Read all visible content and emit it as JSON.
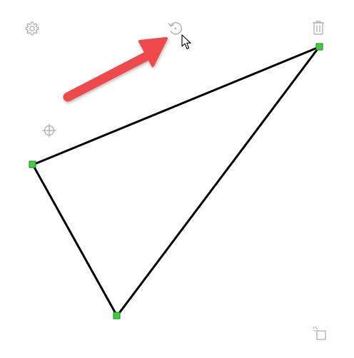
{
  "toolbar": {
    "settings_icon": "gear-icon",
    "rotate_icon": "rotate-icon",
    "delete_icon": "trash-icon",
    "center_icon": "crosshair-icon",
    "resize_icon": "resize-corner-icon"
  },
  "shape": {
    "type": "triangle",
    "stroke_color": "#000000",
    "handle_color": "#3ecf3e"
  },
  "annotation": {
    "arrow_color": "#f0484b",
    "pointer": "mouse-cursor-icon"
  },
  "colors": {
    "icon_gray": "#b5b5b5",
    "background": "#ffffff"
  }
}
